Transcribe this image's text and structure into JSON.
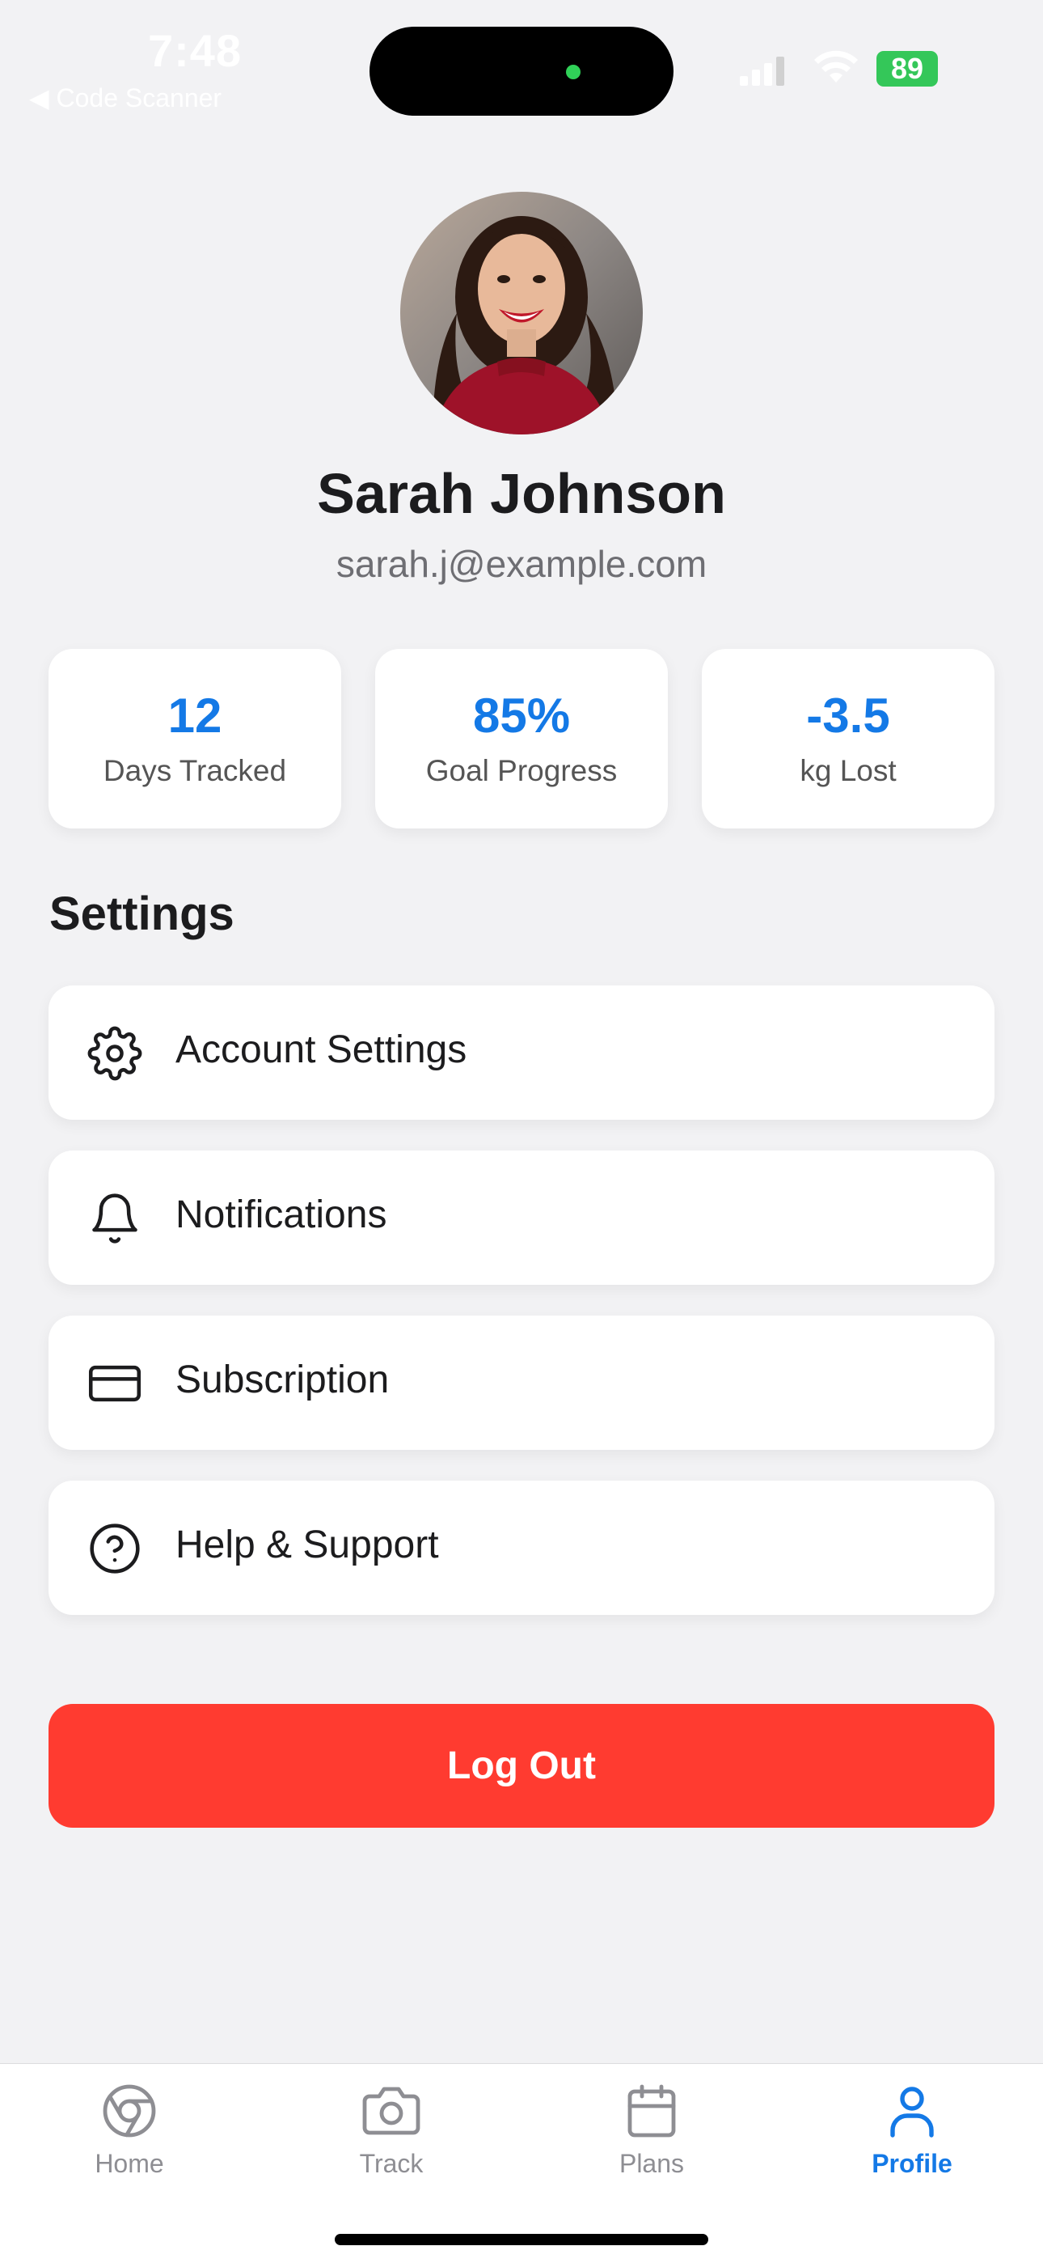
{
  "status_bar": {
    "time": "7:48",
    "back_label": "◀ Code Scanner",
    "battery": "89"
  },
  "profile": {
    "name": "Sarah Johnson",
    "email": "sarah.j@example.com",
    "avatar_icon": "profile-photo"
  },
  "stats": [
    {
      "value": "12",
      "label": "Days Tracked"
    },
    {
      "value": "85%",
      "label": "Goal Progress"
    },
    {
      "value": "-3.5",
      "label": "kg Lost"
    }
  ],
  "settings": {
    "title": "Settings",
    "items": [
      {
        "label": "Account Settings",
        "icon": "gear-icon"
      },
      {
        "label": "Notifications",
        "icon": "bell-icon"
      },
      {
        "label": "Subscription",
        "icon": "credit-card-icon"
      },
      {
        "label": "Help & Support",
        "icon": "help-circle-icon"
      }
    ]
  },
  "logout_label": "Log Out",
  "tabs": [
    {
      "label": "Home",
      "icon": "home-icon",
      "active": false
    },
    {
      "label": "Track",
      "icon": "camera-icon",
      "active": false
    },
    {
      "label": "Plans",
      "icon": "calendar-icon",
      "active": false
    },
    {
      "label": "Profile",
      "icon": "person-icon",
      "active": true
    }
  ],
  "colors": {
    "accent": "#1479e6",
    "danger": "#ff3b30",
    "background": "#f2f2f4",
    "battery": "#34c759"
  }
}
